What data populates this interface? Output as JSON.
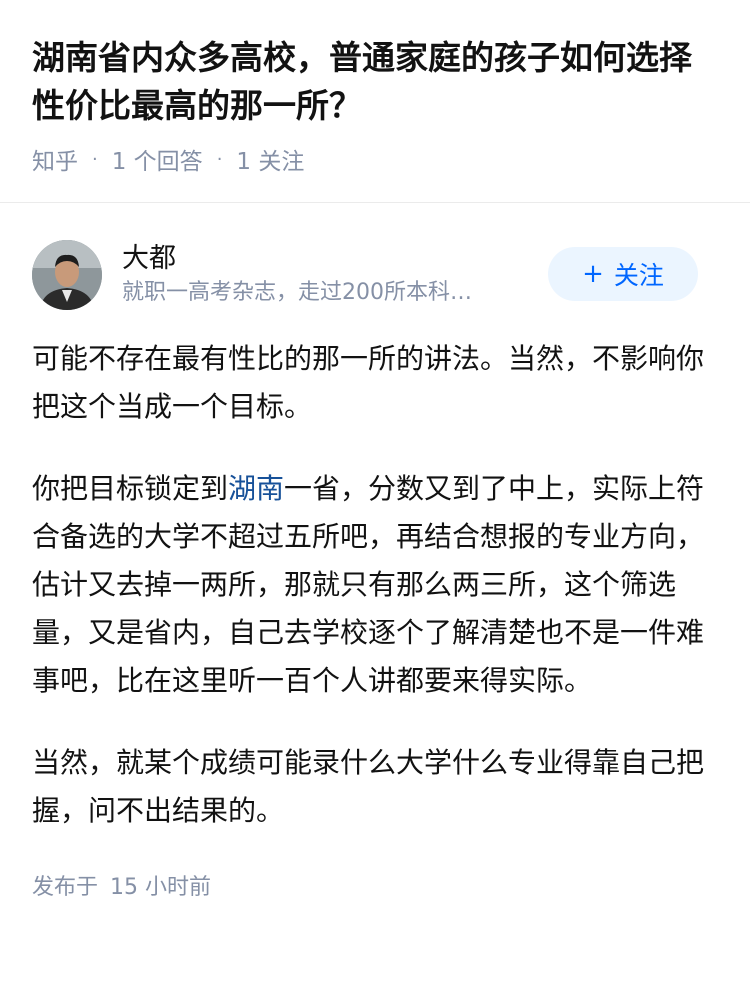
{
  "question": {
    "title": "湖南省内众多高校，普通家庭的孩子如何选择性价比最高的那一所？",
    "source": "知乎",
    "separator": "·",
    "answers": "1 个回答",
    "followers": "1 关注"
  },
  "author": {
    "name": "大都",
    "bio": "就职一高考杂志，走过200所本科…",
    "follow_label": "关注",
    "follow_icon": "+"
  },
  "answer": {
    "p1": "可能不存在最有性比的那一所的讲法。当然，不影响你把这个当成一个目标。",
    "p2_before": "你把目标锁定到",
    "p2_link": "湖南",
    "p2_after": "一省，分数又到了中上，实际上符合备选的大学不超过五所吧，再结合想报的专业方向，估计又去掉一两所，那就只有那么两三所，这个筛选量，又是省内，自己去学校逐个了解清楚也不是一件难事吧，比在这里听一百个人讲都要来得实际。",
    "p3": "当然，就某个成绩可能录什么大学什么专业得靠自己把握，问不出结果的。"
  },
  "publish": {
    "label": "发布于",
    "time": "15 小时前"
  },
  "colors": {
    "link": "#175199",
    "accent": "#0066ff",
    "follow_bg": "#ebf5ff",
    "meta": "#8590a6"
  }
}
